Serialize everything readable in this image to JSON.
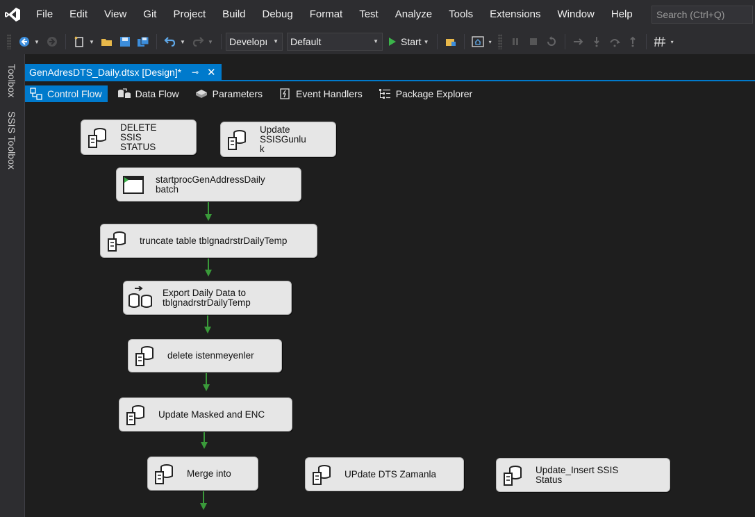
{
  "menu": {
    "items": [
      "File",
      "Edit",
      "View",
      "Git",
      "Project",
      "Build",
      "Debug",
      "Format",
      "Test",
      "Analyze",
      "Tools",
      "Extensions",
      "Window",
      "Help"
    ],
    "search_placeholder": "Search (Ctrl+Q)"
  },
  "toolbar": {
    "solution_config": "Developı",
    "platform": "Default",
    "start_label": "Start"
  },
  "side_tabs": {
    "toolbox": "Toolbox",
    "ssis_toolbox": "SSIS Toolbox"
  },
  "document": {
    "tab_title": "GenAdresDTS_Daily.dtsx [Design]*",
    "pin_glyph": "⊸",
    "close_glyph": "✕"
  },
  "designer_tabs": [
    {
      "label": "Control Flow",
      "active": true
    },
    {
      "label": "Data Flow",
      "active": false
    },
    {
      "label": "Parameters",
      "active": false
    },
    {
      "label": "Event Handlers",
      "active": false
    },
    {
      "label": "Package Explorer",
      "active": false
    }
  ],
  "tasks": {
    "delete_ssis_status": {
      "label": "DELETE\nSSIS\nSTATUS",
      "icon": "sql-task-icon"
    },
    "update_ssis_gunluk": {
      "label": "Update\nSSISGunlu\nk",
      "icon": "sql-task-icon"
    },
    "start_proc": {
      "label": "startprocGenAddressDaily\nbatch",
      "icon": "execute-process-icon"
    },
    "truncate_table": {
      "label": "truncate table tblgnadrstrDailyTemp",
      "icon": "sql-task-icon"
    },
    "export_daily": {
      "label": "Export Daily Data to\ntblgnadrstrDailyTemp",
      "icon": "data-flow-task-icon"
    },
    "delete_istenmeyenler": {
      "label": "delete istenmeyenler",
      "icon": "sql-task-icon"
    },
    "update_masked": {
      "label": "Update Masked and ENC",
      "icon": "sql-task-icon"
    },
    "merge_into": {
      "label": "Merge into",
      "icon": "sql-task-icon"
    },
    "update_dts_zamanla": {
      "label": "UPdate DTS Zamanla",
      "icon": "sql-task-icon"
    },
    "update_insert_status": {
      "label": "Update_Insert SSIS\nStatus",
      "icon": "sql-task-icon"
    }
  },
  "colors": {
    "accent": "#007acc",
    "precedence_success": "#3a9a3a",
    "task_fill": "#e6e6e6",
    "canvas": "#1e1e1e",
    "chrome": "#2d2d30"
  }
}
